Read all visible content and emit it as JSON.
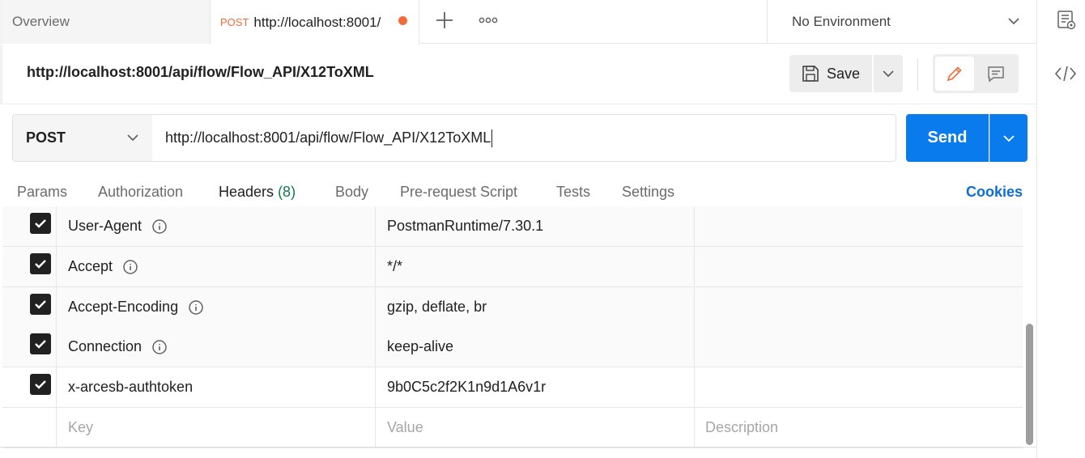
{
  "tabs": {
    "overview_label": "Overview",
    "active": {
      "method": "POST",
      "url": "http://localhost:8001/"
    }
  },
  "environment": {
    "selected": "No Environment"
  },
  "request": {
    "name": "http://localhost:8001/api/flow/Flow_API/X12ToXML",
    "method": "POST",
    "url": "http://localhost:8001/api/flow/Flow_API/X12ToXML"
  },
  "actions": {
    "save_label": "Save",
    "send_label": "Send"
  },
  "request_tabs": {
    "params": "Params",
    "authorization": "Authorization",
    "headers": "Headers",
    "headers_count": "(8)",
    "body": "Body",
    "prerequest": "Pre-request Script",
    "tests": "Tests",
    "settings": "Settings",
    "cookies": "Cookies"
  },
  "headers": {
    "rows": [
      {
        "key": "User-Agent",
        "value": "PostmanRuntime/7.30.1"
      },
      {
        "key": "Accept",
        "value": "*/*"
      },
      {
        "key": "Accept-Encoding",
        "value": "gzip, deflate, br"
      },
      {
        "key": "Connection",
        "value": "keep-alive"
      },
      {
        "key": "x-arcesb-authtoken",
        "value": "9b0C5c2f2K1n9d1A6v1r"
      }
    ],
    "placeholders": {
      "key": "Key",
      "value": "Value",
      "description": "Description"
    }
  },
  "colors": {
    "accent": "#f26b3a",
    "send": "#097bed",
    "link": "#0b6ed6",
    "count": "#0f7a46"
  }
}
